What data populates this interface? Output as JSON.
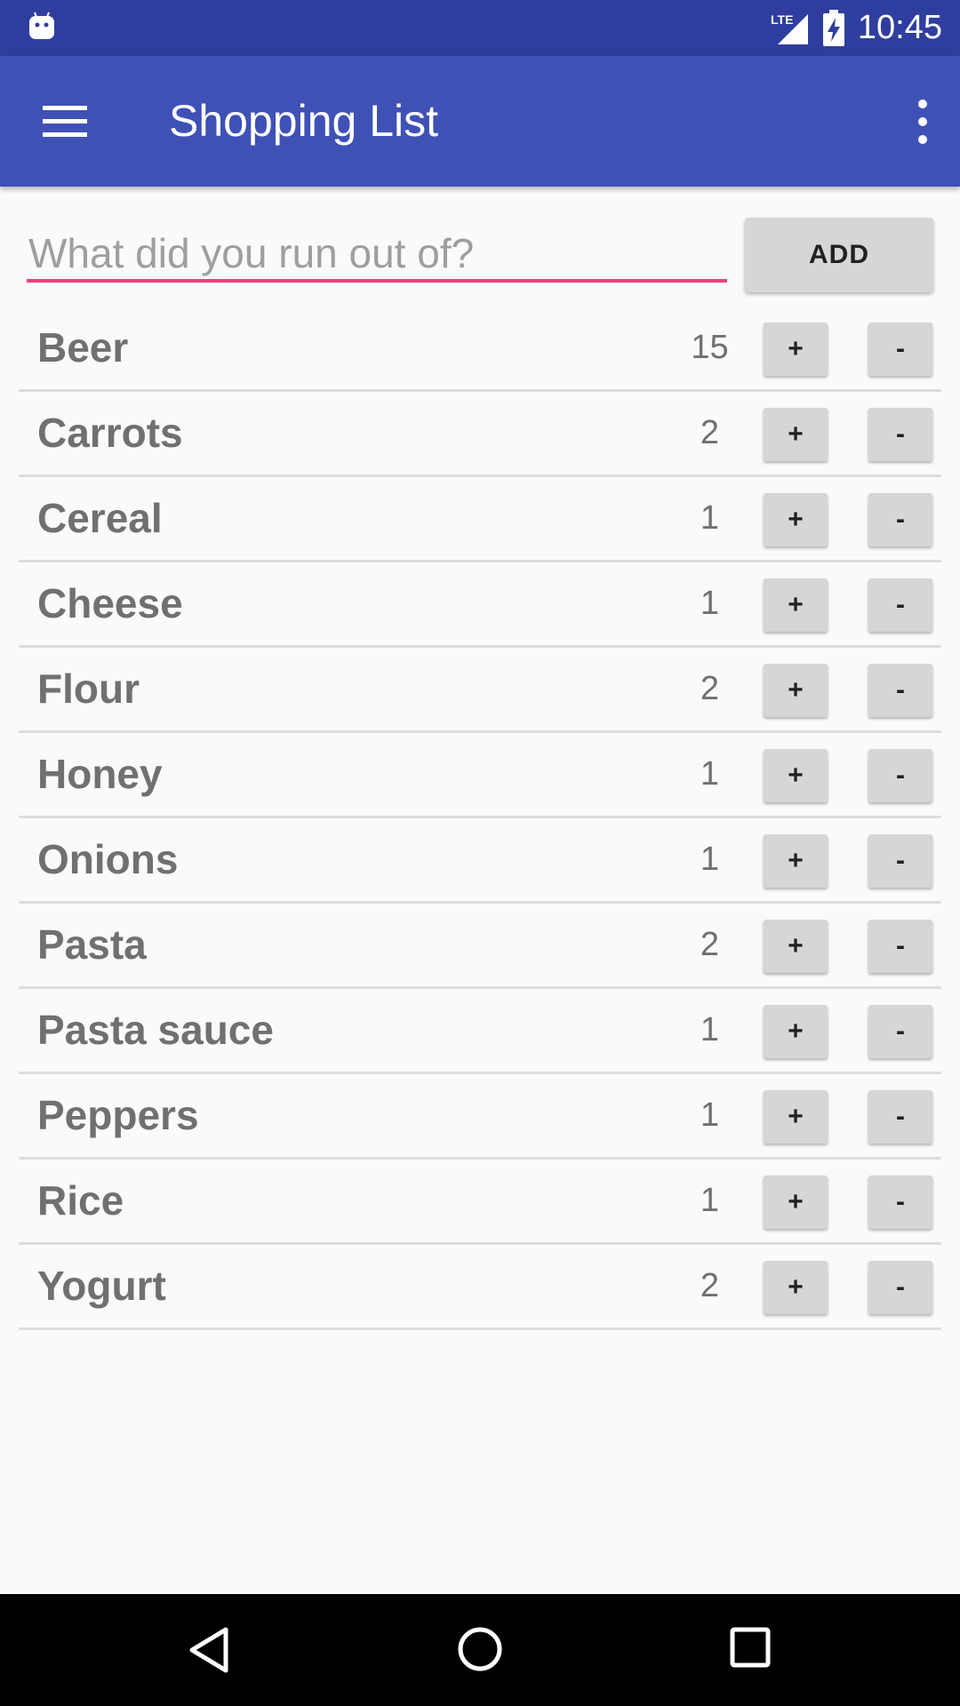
{
  "status_bar": {
    "time": "10:45",
    "network_label": "LTE",
    "icons": [
      "android-icon",
      "lte-signal-icon",
      "battery-charging-icon"
    ]
  },
  "app_bar": {
    "title": "Shopping List",
    "icons": [
      "menu-icon",
      "more-vert-icon"
    ]
  },
  "input": {
    "placeholder": "What did you run out of?",
    "value": "",
    "underline_color": "#e8417b"
  },
  "add_button": {
    "label": "ADD"
  },
  "items": [
    {
      "name": "Beer",
      "qty": "15",
      "plus": "+",
      "minus": "-"
    },
    {
      "name": "Carrots",
      "qty": "2",
      "plus": "+",
      "minus": "-"
    },
    {
      "name": "Cereal",
      "qty": "1",
      "plus": "+",
      "minus": "-"
    },
    {
      "name": "Cheese",
      "qty": "1",
      "plus": "+",
      "minus": "-"
    },
    {
      "name": "Flour",
      "qty": "2",
      "plus": "+",
      "minus": "-"
    },
    {
      "name": "Honey",
      "qty": "1",
      "plus": "+",
      "minus": "-"
    },
    {
      "name": "Onions",
      "qty": "1",
      "plus": "+",
      "minus": "-"
    },
    {
      "name": "Pasta",
      "qty": "2",
      "plus": "+",
      "minus": "-"
    },
    {
      "name": "Pasta sauce",
      "qty": "1",
      "plus": "+",
      "minus": "-"
    },
    {
      "name": "Peppers",
      "qty": "1",
      "plus": "+",
      "minus": "-"
    },
    {
      "name": "Rice",
      "qty": "1",
      "plus": "+",
      "minus": "-"
    },
    {
      "name": "Yogurt",
      "qty": "2",
      "plus": "+",
      "minus": "-"
    }
  ],
  "nav_bar": {
    "icons": [
      "back-icon",
      "home-icon",
      "recents-icon"
    ]
  },
  "colors": {
    "status_bar": "#2f3e9e",
    "app_bar": "#3f51b5",
    "accent": "#e8417b",
    "button": "#d6d6d6"
  }
}
